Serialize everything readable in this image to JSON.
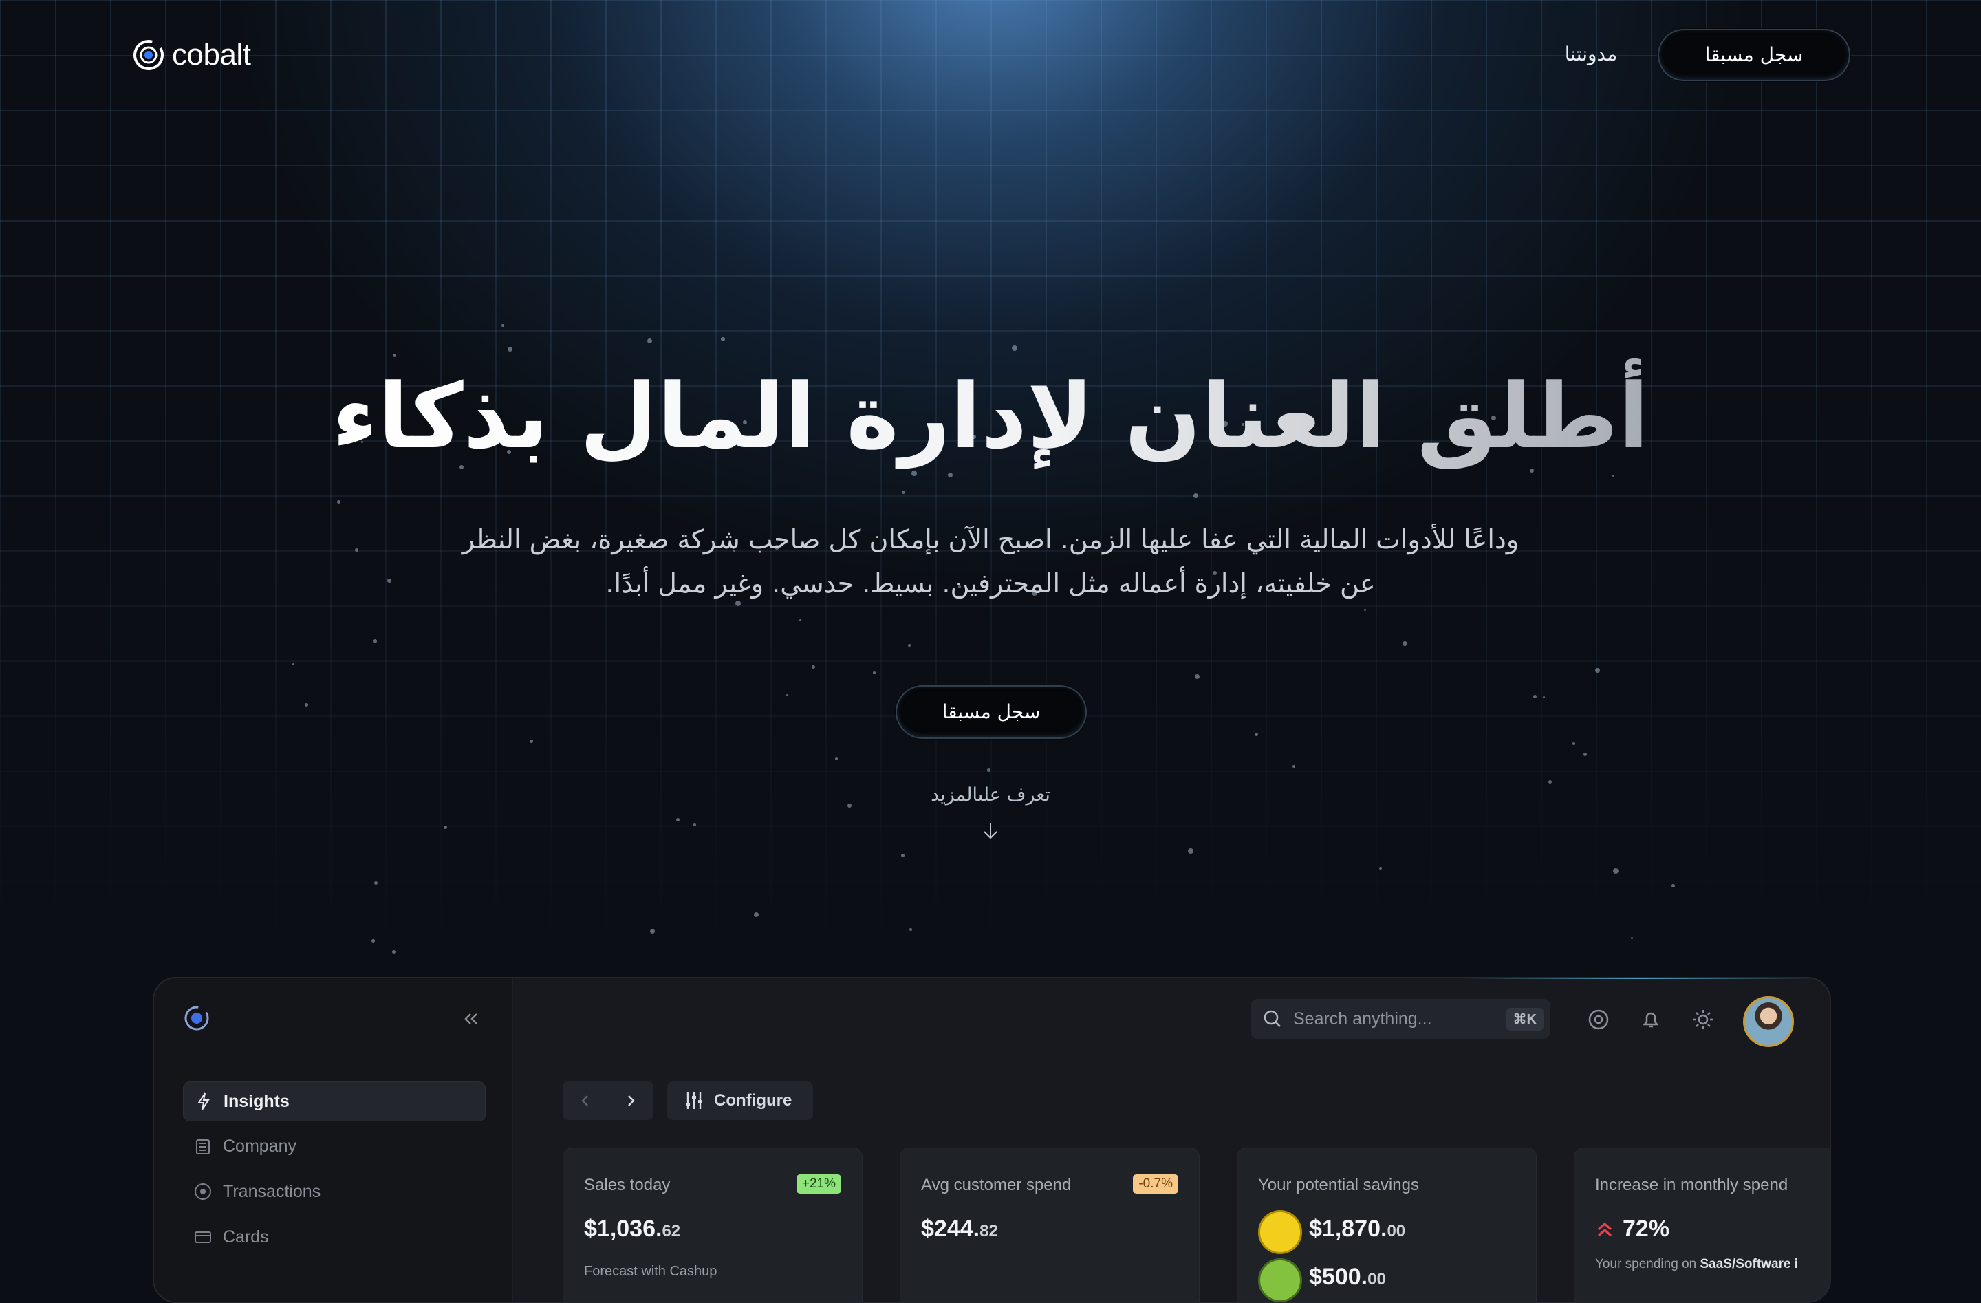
{
  "header": {
    "logo_text": "cobalt",
    "nav_blog": "مدونتنا",
    "register_label": "سجل مسبقا"
  },
  "hero": {
    "title": "أطلق العنان لإدارة المال بذكاء",
    "subtitle_line1": "وداعًا للأدوات المالية التي عفا عليها الزمن. اصبح الآن بإمكان كل صاحب شركة صغيرة، بغض النظر",
    "subtitle_line2": "عن خلفيته، إدارة أعماله مثل المحترفين. بسيط. حدسي. وغير ممل أبدًا.",
    "cta_label": "سجل مسبقا",
    "learn_more": "تعرف علىالمزيد"
  },
  "dashboard": {
    "sidebar": {
      "items": [
        {
          "label": "Insights",
          "icon": "sparkle-icon",
          "active": true
        },
        {
          "label": "Company",
          "icon": "building-icon"
        },
        {
          "label": "Transactions",
          "icon": "dollar-circle-icon"
        },
        {
          "label": "Cards",
          "icon": "card-icon"
        }
      ]
    },
    "search": {
      "placeholder": "Search anything...",
      "shortcut": "⌘K"
    },
    "toolbar": {
      "configure_label": "Configure"
    },
    "cards": [
      {
        "title": "Sales today",
        "badge": "+21%",
        "value_main": "$1,036.",
        "value_cents": "62",
        "sub": "Forecast with Cashup"
      },
      {
        "title": "Avg customer spend",
        "badge": "-0.7%",
        "value_main": "$244.",
        "value_cents": "82"
      },
      {
        "title": "Your potential savings",
        "value_main": "$1,870.",
        "value_cents": "00",
        "value2_main": "$500.",
        "value2_cents": "00"
      },
      {
        "title": "Increase in monthly spend",
        "value": "72%",
        "sub_prefix": "Your spending on ",
        "sub_bold": "SaaS/Software i"
      }
    ],
    "colors": {
      "badge_green": "#8ee37b",
      "badge_orange": "#f6c987",
      "accent_red": "#e0434d"
    }
  }
}
